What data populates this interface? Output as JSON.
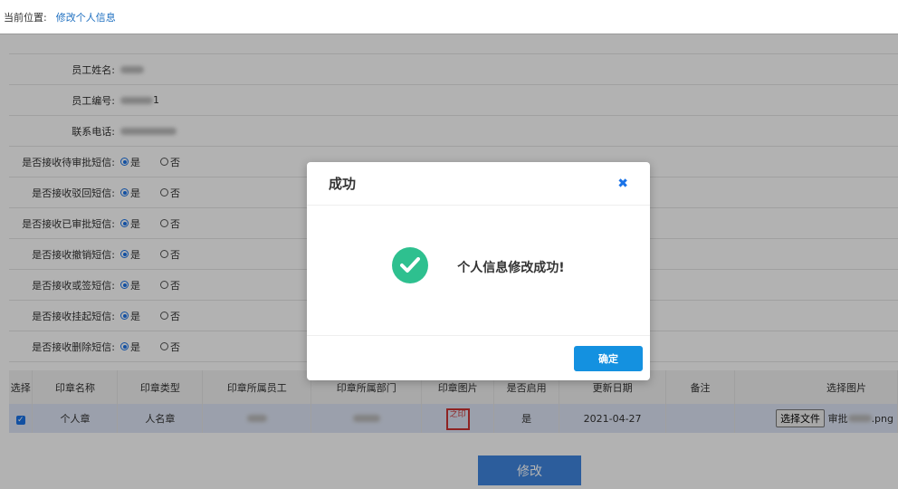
{
  "breadcrumb": {
    "label": "当前位置:",
    "current": "修改个人信息"
  },
  "form": {
    "fields": [
      {
        "label": "员工姓名:"
      },
      {
        "label": "员工编号:",
        "suffix": "1"
      },
      {
        "label": "联系电话:"
      }
    ],
    "radio_rows": [
      {
        "label": "是否接收待审批短信:",
        "yes": "是",
        "no": "否",
        "selected": "是"
      },
      {
        "label": "是否接收驳回短信:",
        "yes": "是",
        "no": "否",
        "selected": "是"
      },
      {
        "label": "是否接收已审批短信:",
        "yes": "是",
        "no": "否",
        "selected": "是"
      },
      {
        "label": "是否接收撤销短信:",
        "yes": "是",
        "no": "否",
        "selected": "是"
      },
      {
        "label": "是否接收或签短信:",
        "yes": "是",
        "no": "否",
        "selected": "是"
      },
      {
        "label": "是否接收挂起短信:",
        "yes": "是",
        "no": "否",
        "selected": "是"
      },
      {
        "label": "是否接收删除短信:",
        "yes": "是",
        "no": "否",
        "selected": "是"
      }
    ]
  },
  "table": {
    "headers": [
      "选择",
      "印章名称",
      "印章类型",
      "印章所属员工",
      "印章所属部门",
      "印章图片",
      "是否启用",
      "更新日期",
      "备注",
      "选择图片"
    ],
    "row": {
      "name": "个人章",
      "type": "人名章",
      "enabled": "是",
      "date": "2021-04-27",
      "file_button": "选择文件",
      "file_prefix": "审批",
      "file_suffix": ".png",
      "stamp_text": "之印"
    }
  },
  "submit_label": "修改",
  "modal": {
    "title": "成功",
    "close_symbol": "✖",
    "message": "个人信息修改成功!",
    "ok_label": "确定"
  },
  "colors": {
    "accent": "#1491e0",
    "success": "#2ec08f",
    "submit": "#3f86e0"
  }
}
